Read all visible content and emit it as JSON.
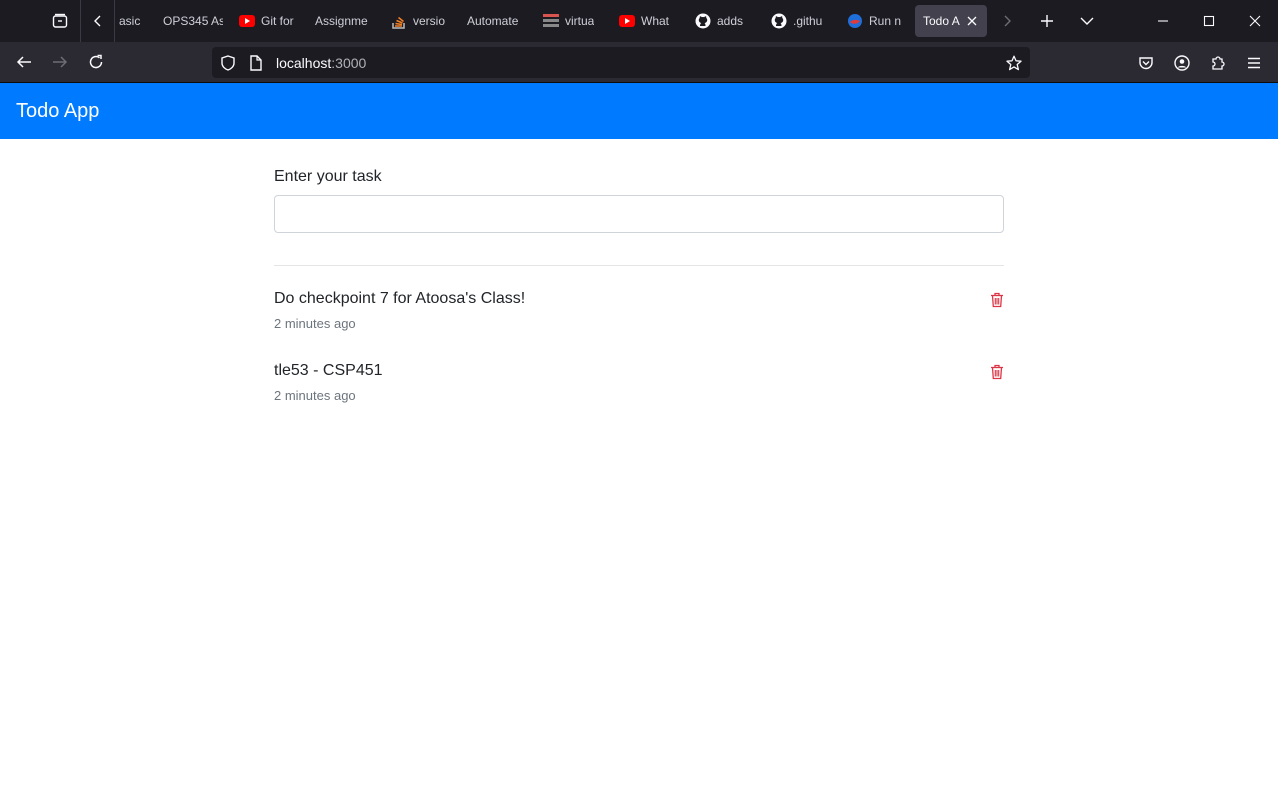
{
  "browser": {
    "tabs": [
      {
        "label": "asic",
        "icon": "none"
      },
      {
        "label": "OPS345 As",
        "icon": "none"
      },
      {
        "label": "Git for",
        "icon": "youtube-icon"
      },
      {
        "label": "Assignme",
        "icon": "none"
      },
      {
        "label": "versio",
        "icon": "stackoverflow-icon"
      },
      {
        "label": "Automate",
        "icon": "none"
      },
      {
        "label": "virtua",
        "icon": "grid-icon"
      },
      {
        "label": "What",
        "icon": "youtube-icon"
      },
      {
        "label": "adds",
        "icon": "github-icon"
      },
      {
        "label": ".githu",
        "icon": "github-icon"
      },
      {
        "label": "Run n",
        "icon": "globe-icon"
      },
      {
        "label": "Todo Ap",
        "icon": "none",
        "active": true
      }
    ],
    "url_host": "localhost",
    "url_port": ":3000"
  },
  "app": {
    "title": "Todo App",
    "input_label": "Enter your task",
    "input_value": "",
    "todos": [
      {
        "text": "Do checkpoint 7 for Atoosa's Class!",
        "time": "2 minutes ago"
      },
      {
        "text": "tle53 - CSP451",
        "time": "2 minutes ago"
      }
    ]
  },
  "colors": {
    "accent": "#007bff",
    "danger": "#dc3545",
    "browser_bg": "#1c1b22",
    "toolbar_bg": "#2b2a33"
  }
}
